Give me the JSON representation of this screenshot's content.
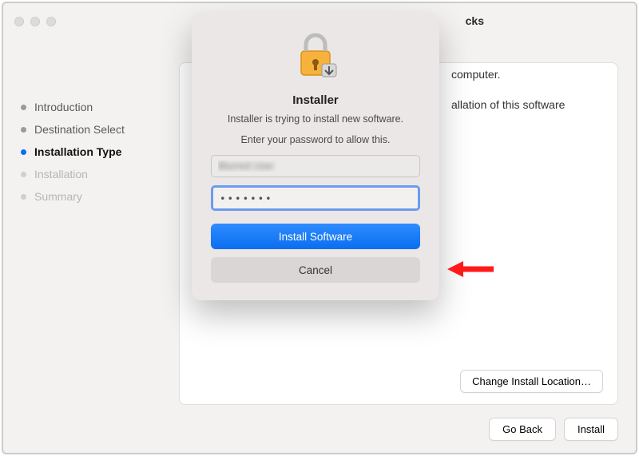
{
  "window": {
    "title_fragment": "cks"
  },
  "sidebar": {
    "steps": [
      {
        "label": "Introduction",
        "state": "done"
      },
      {
        "label": "Destination Select",
        "state": "done"
      },
      {
        "label": "Installation Type",
        "state": "active"
      },
      {
        "label": "Installation",
        "state": "pending"
      },
      {
        "label": "Summary",
        "state": "pending"
      }
    ]
  },
  "background": {
    "line1_fragment": "computer.",
    "line2_fragment": "allation of this software",
    "change_location": "Change Install Location…"
  },
  "footer": {
    "go_back": "Go Back",
    "install": "Install"
  },
  "dialog": {
    "title": "Installer",
    "message": "Installer is trying to install new software.",
    "prompt": "Enter your password to allow this.",
    "username_value": "Blurred User",
    "password_value": "•••••••",
    "primary": "Install Software",
    "secondary": "Cancel"
  }
}
